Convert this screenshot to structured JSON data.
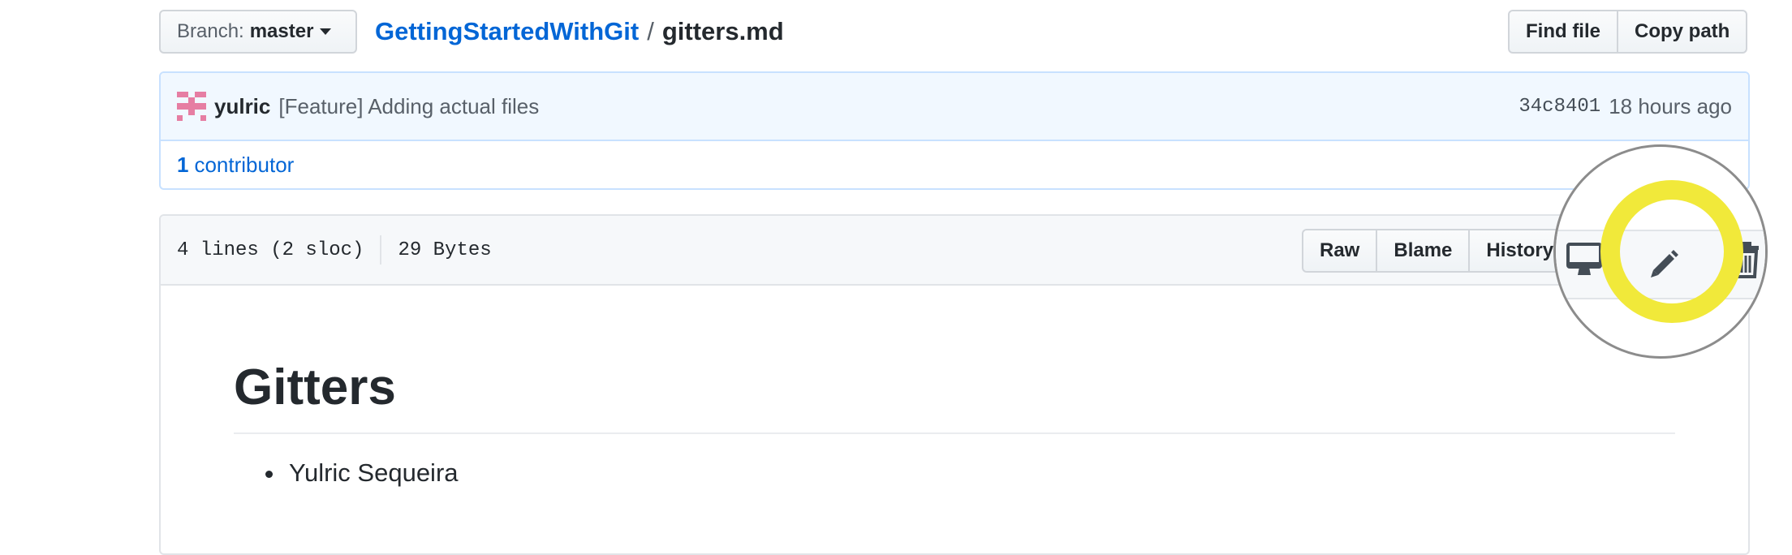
{
  "branch": {
    "prefix": "Branch:",
    "name": "master"
  },
  "breadcrumb": {
    "repo": "GettingStartedWithGit",
    "separator": "/",
    "file": "gitters.md"
  },
  "top_actions": {
    "find_file": "Find file",
    "copy_path": "Copy path"
  },
  "commit": {
    "author": "yulric",
    "message": "[Feature] Adding actual files",
    "sha": "34c8401",
    "time": "18 hours ago",
    "contributors_count": "1",
    "contributors_label": "contributor"
  },
  "file": {
    "lines_info": "4 lines (2 sloc)",
    "size": "29 Bytes",
    "buttons": {
      "raw": "Raw",
      "blame": "Blame",
      "history": "History"
    }
  },
  "content": {
    "heading": "Gitters",
    "list": [
      "Yulric Sequeira"
    ]
  },
  "icons": {
    "desktop": "desktop-icon",
    "edit": "pencil-icon",
    "delete": "trash-icon"
  },
  "colors": {
    "link": "#0366d6",
    "highlight_ring": "#f1e93a",
    "avatar": "#e67ea3"
  }
}
